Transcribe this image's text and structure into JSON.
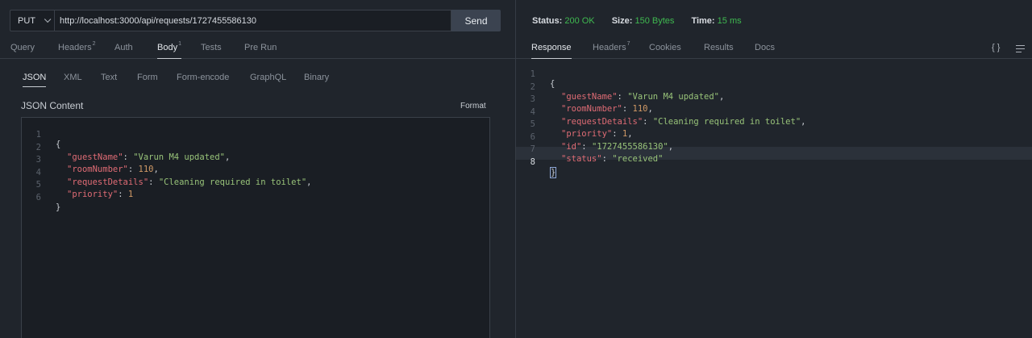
{
  "request": {
    "method": "PUT",
    "url": "http://localhost:3000/api/requests/1727455586130",
    "send_label": "Send"
  },
  "left_tabs": [
    {
      "label": "Query",
      "badge": ""
    },
    {
      "label": "Headers",
      "badge": "2"
    },
    {
      "label": "Auth",
      "badge": ""
    },
    {
      "label": "Body",
      "badge": "1"
    },
    {
      "label": "Tests",
      "badge": ""
    },
    {
      "label": "Pre Run",
      "badge": ""
    }
  ],
  "body_tabs": [
    "JSON",
    "XML",
    "Text",
    "Form",
    "Form-encode",
    "GraphQL",
    "Binary"
  ],
  "content_title": "JSON Content",
  "format_label": "Format",
  "request_body": {
    "line_numbers": [
      "1",
      "2",
      "3",
      "4",
      "5",
      "6"
    ],
    "open_brace": "{",
    "close_brace": "}",
    "fields": [
      {
        "key": "\"guestName\"",
        "value": "\"Varun M4 updated\"",
        "trail": ","
      },
      {
        "key": "\"roomNumber\"",
        "value": "110",
        "trail": ","
      },
      {
        "key": "\"requestDetails\"",
        "value": "\"Cleaning required in toilet\"",
        "trail": ","
      },
      {
        "key": "\"priority\"",
        "value": "1",
        "trail": ""
      }
    ]
  },
  "status": {
    "status_label": "Status:",
    "status_value": "200 OK",
    "size_label": "Size:",
    "size_value": "150 Bytes",
    "time_label": "Time:",
    "time_value": "15 ms"
  },
  "right_tabs": [
    {
      "label": "Response",
      "badge": ""
    },
    {
      "label": "Headers",
      "badge": "7"
    },
    {
      "label": "Cookies",
      "badge": ""
    },
    {
      "label": "Results",
      "badge": ""
    },
    {
      "label": "Docs",
      "badge": ""
    }
  ],
  "right_icons": {
    "braces": "{ }"
  },
  "response_body": {
    "line_numbers": [
      "1",
      "2",
      "3",
      "4",
      "5",
      "6",
      "7",
      "8"
    ],
    "open_brace": "{",
    "close_brace": "}",
    "fields": [
      {
        "key": "\"guestName\"",
        "value": "\"Varun M4 updated\"",
        "trail": ","
      },
      {
        "key": "\"roomNumber\"",
        "value": "110",
        "trail": ","
      },
      {
        "key": "\"requestDetails\"",
        "value": "\"Cleaning required in toilet\"",
        "trail": ","
      },
      {
        "key": "\"priority\"",
        "value": "1",
        "trail": ","
      },
      {
        "key": "\"id\"",
        "value": "\"1727455586130\"",
        "trail": ","
      },
      {
        "key": "\"status\"",
        "value": "\"received\"",
        "trail": ""
      }
    ]
  },
  "colors": {
    "background": "#20252c",
    "success": "#3fb950",
    "json_key": "#e06c75",
    "json_string": "#98c379",
    "json_number": "#d19a66"
  }
}
